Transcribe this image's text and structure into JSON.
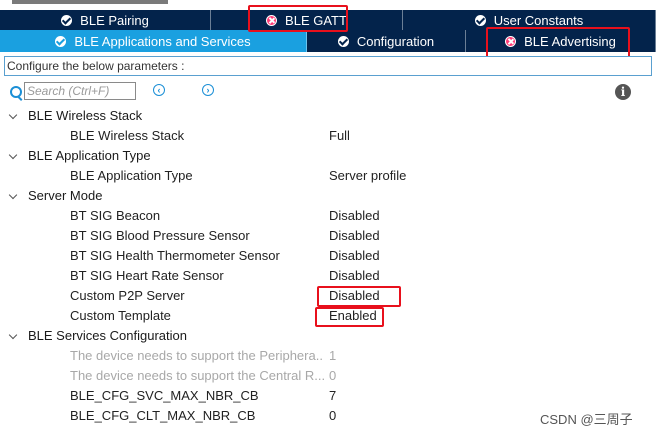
{
  "tabs_row1": [
    {
      "label": "BLE Pairing",
      "status": "ok",
      "width": 211
    },
    {
      "label": "BLE GATT",
      "status": "error",
      "width": 192
    },
    {
      "label": "User Constants",
      "status": "ok",
      "width": 253
    }
  ],
  "tabs_row2": [
    {
      "label": "BLE Applications and Services",
      "status": "ok",
      "active": true,
      "width": 307
    },
    {
      "label": "Configuration",
      "status": "ok",
      "active": false,
      "width": 159
    },
    {
      "label": "BLE Advertising",
      "status": "error",
      "active": false,
      "width": 190
    }
  ],
  "caption": "Configure the below parameters :",
  "search": {
    "placeholder": "Search (Ctrl+F)"
  },
  "tree": [
    {
      "type": "group",
      "label": "BLE Wireless Stack"
    },
    {
      "type": "item",
      "label": "BLE Wireless Stack",
      "value": "Full"
    },
    {
      "type": "group",
      "label": "BLE Application Type"
    },
    {
      "type": "item",
      "label": "BLE Application Type",
      "value": "Server profile"
    },
    {
      "type": "group",
      "label": "Server Mode"
    },
    {
      "type": "item",
      "label": "BT SIG Beacon",
      "value": "Disabled"
    },
    {
      "type": "item",
      "label": "BT SIG Blood Pressure Sensor",
      "value": "Disabled"
    },
    {
      "type": "item",
      "label": "BT SIG Health Thermometer Sensor",
      "value": "Disabled"
    },
    {
      "type": "item",
      "label": "BT SIG Heart Rate Sensor",
      "value": "Disabled"
    },
    {
      "type": "item",
      "label": "Custom P2P Server",
      "value": "Disabled"
    },
    {
      "type": "item",
      "label": "Custom Template",
      "value": "Enabled"
    },
    {
      "type": "group",
      "label": "BLE Services Configuration"
    },
    {
      "type": "item",
      "label": "The device needs to support the Peripheral Role",
      "display": "The device needs to support the Periphera...",
      "value": "1",
      "disabled": true
    },
    {
      "type": "item",
      "label": "The device needs to support the Central Role",
      "display": "The device needs to support the Central R...",
      "value": "0",
      "disabled": true
    },
    {
      "type": "item",
      "label": "BLE_CFG_SVC_MAX_NBR_CB",
      "value": "7"
    },
    {
      "type": "item",
      "label": "BLE_CFG_CLT_MAX_NBR_CB",
      "value": "0"
    }
  ],
  "watermark": "CSDN @三周子",
  "colors": {
    "tab_dark": "#03234b",
    "tab_active": "#1aa0e0",
    "highlight": "#e8101c",
    "error_icon": "#ff3c78"
  }
}
